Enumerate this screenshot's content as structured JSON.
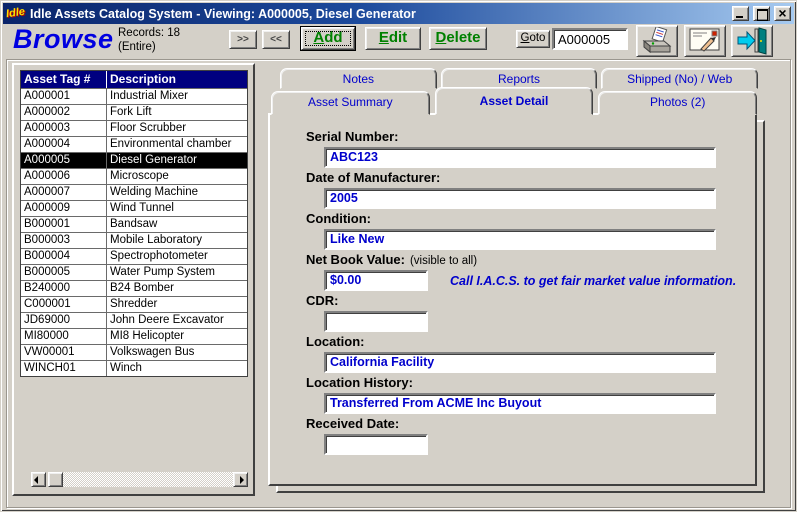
{
  "window": {
    "title": "Idle Assets Catalog System - Viewing: A000005, Diesel Generator",
    "app_icon_text": "Idle"
  },
  "toolbar": {
    "mode_label": "Browse",
    "records_line1": "Records: 18",
    "records_line2": "(Entire)",
    "next_label": ">>",
    "prev_label": "<<",
    "add_label": "Add",
    "edit_label": "Edit",
    "delete_label": "Delete",
    "goto_label": "Goto",
    "goto_value": "A000005",
    "icons": [
      "printer-icon",
      "mail-report-icon",
      "exit-icon"
    ]
  },
  "list": {
    "columns": [
      "Asset Tag #",
      "Description"
    ],
    "selected_tag": "A000005",
    "rows": [
      [
        "A000001",
        "Industrial Mixer"
      ],
      [
        "A000002",
        "Fork Lift"
      ],
      [
        "A000003",
        "Floor Scrubber"
      ],
      [
        "A000004",
        "Environmental chamber"
      ],
      [
        "A000005",
        "Diesel Generator"
      ],
      [
        "A000006",
        "Microscope"
      ],
      [
        "A000007",
        "Welding Machine"
      ],
      [
        "A000009",
        "Wind Tunnel"
      ],
      [
        "B000001",
        "Bandsaw"
      ],
      [
        "B000003",
        "Mobile Laboratory"
      ],
      [
        "B000004",
        "Spectrophotometer"
      ],
      [
        "B000005",
        "Water Pump System"
      ],
      [
        "B240000",
        "B24 Bomber"
      ],
      [
        "C000001",
        "Shredder"
      ],
      [
        "JD69000",
        "John Deere Excavator"
      ],
      [
        "MI80000",
        "MI8 Helicopter"
      ],
      [
        "VW00001",
        "Volkswagen Bus"
      ],
      [
        "WINCH01",
        "Winch"
      ]
    ]
  },
  "tabs": {
    "row1": [
      "Notes",
      "Reports",
      "Shipped (No) / Web"
    ],
    "row2": [
      "Asset Summary",
      "Asset Detail",
      "Photos (2)"
    ],
    "active": "Asset Detail"
  },
  "form": {
    "fields": [
      {
        "label": "Serial Number:",
        "value": "ABC123",
        "size": "wide"
      },
      {
        "label": "Date of Manufacturer:",
        "value": "2005",
        "size": "wide"
      },
      {
        "label": "Condition:",
        "value": "Like New",
        "size": "wide"
      },
      {
        "label": "Net Book Value:",
        "hint": "(visible to all)",
        "value": "$0.00",
        "size": "short",
        "note": "Call I.A.C.S. to get fair market value information."
      },
      {
        "label": "CDR:",
        "value": "",
        "size": "short"
      },
      {
        "label": "Location:",
        "value": "California Facility",
        "size": "wide"
      },
      {
        "label": "Location History:",
        "value": "Transferred From ACME Inc Buyout",
        "size": "wide"
      },
      {
        "label": "Received Date:",
        "value": "",
        "size": "short"
      }
    ]
  },
  "colors": {
    "titlebar_start": "#0a246a",
    "titlebar_end": "#a6caf0",
    "value_blue": "#0000cc",
    "button_green": "#008000",
    "header_navy": "#000080",
    "chrome_gray": "#d4d0c8"
  }
}
